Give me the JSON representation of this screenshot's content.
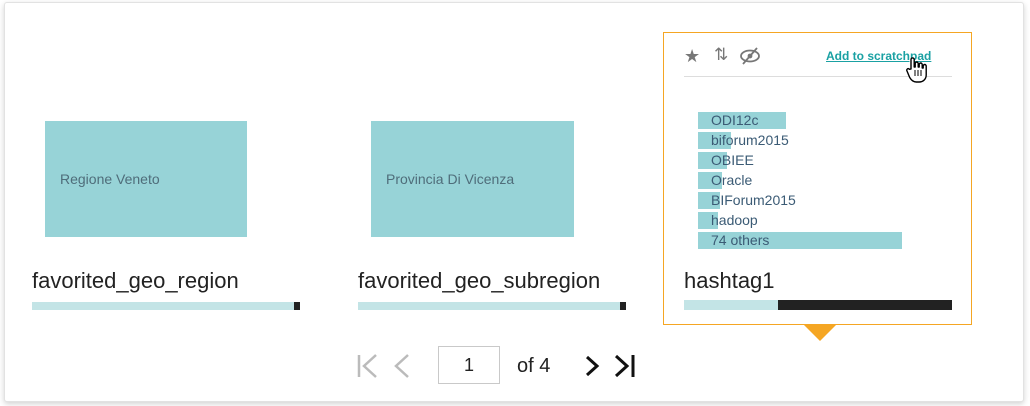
{
  "cards": [
    {
      "tile_label": "Regione Veneto",
      "title": "favorited_geo_region",
      "fill_fraction": 0.02
    },
    {
      "tile_label": "Provincia Di Vicenza",
      "title": "favorited_geo_subregion",
      "fill_fraction": 0.02
    },
    {
      "title": "hashtag1",
      "fill_fraction": 0.65
    }
  ],
  "selected_card": {
    "icons": [
      "star-icon",
      "sort-icon",
      "hide-icon"
    ],
    "scratchpad_link": "Add to scratchpad",
    "rows": [
      {
        "label": "ODI12c",
        "fraction": 0.43
      },
      {
        "label": "biforum2015",
        "fraction": 0.16
      },
      {
        "label": "OBIEE",
        "fraction": 0.14
      },
      {
        "label": "Oracle",
        "fraction": 0.12
      },
      {
        "label": "BIForum2015",
        "fraction": 0.11
      },
      {
        "label": "hadoop",
        "fraction": 0.1
      },
      {
        "label": "74 others",
        "fraction": 1.0
      }
    ]
  },
  "pagination": {
    "current_page": "1",
    "of_label": "of 4",
    "first_icon": "first-page-icon",
    "prev_icon": "prev-page-icon",
    "next_icon": "next-page-icon",
    "last_icon": "last-page-icon"
  }
}
